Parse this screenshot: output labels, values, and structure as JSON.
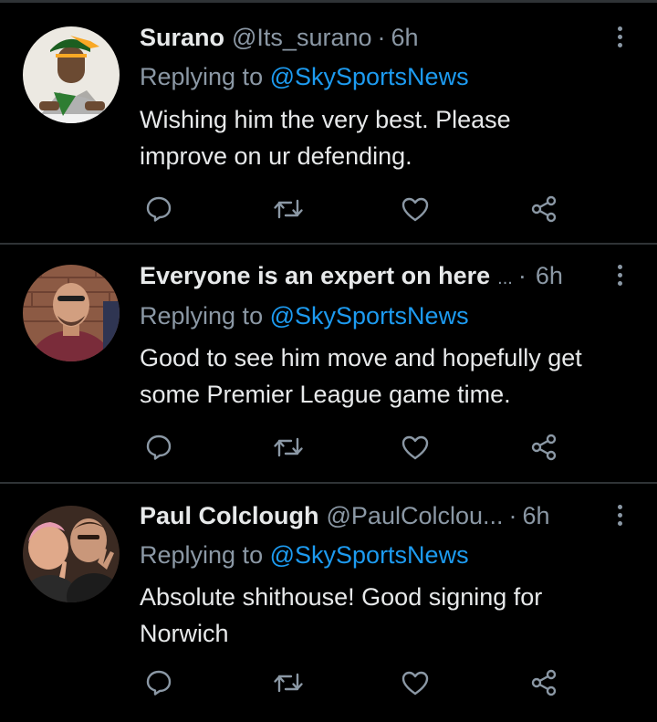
{
  "colors": {
    "background": "#000000",
    "text_primary": "#e7e9ea",
    "text_secondary": "#8b98a5",
    "link": "#1d9bf0",
    "divider": "#2f3336"
  },
  "tweets": [
    {
      "display_name": "Surano",
      "handle": "@Its_surano",
      "separator": "·",
      "time": "6h",
      "replying_prefix": "Replying to",
      "replying_mention": "@SkySportsNews",
      "text_lines": [
        "Wishing him the very best. Please",
        "improve on ur defending."
      ],
      "icons": [
        "reply-icon",
        "retweet-icon",
        "like-icon",
        "share-icon"
      ]
    },
    {
      "display_name": "Everyone is an expert on here",
      "ellipsis": "...",
      "separator": "·",
      "time": "6h",
      "replying_prefix": "Replying to",
      "replying_mention": "@SkySportsNews",
      "text_lines": [
        "Good to see him move and hopefully get",
        "some Premier League game time."
      ],
      "icons": [
        "reply-icon",
        "retweet-icon",
        "like-icon",
        "share-icon"
      ]
    },
    {
      "display_name": "Paul Colclough",
      "handle": "@PaulColclou...",
      "separator": "·",
      "time": "6h",
      "replying_prefix": "Replying to",
      "replying_mention": "@SkySportsNews",
      "text_lines": [
        "Absolute shithouse! Good signing for",
        "Norwich"
      ],
      "icons": [
        "reply-icon",
        "retweet-icon",
        "like-icon",
        "share-icon"
      ]
    }
  ]
}
